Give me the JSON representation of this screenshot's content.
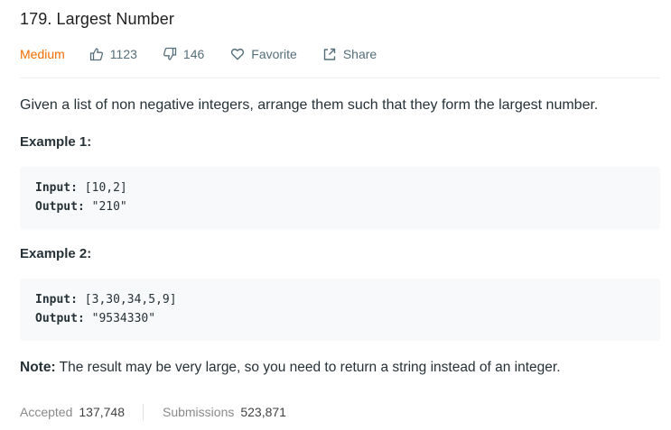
{
  "problem": {
    "title": "179. Largest Number",
    "difficulty": "Medium",
    "likes": "1123",
    "dislikes": "146",
    "favorite_label": "Favorite",
    "share_label": "Share"
  },
  "description": "Given a list of non negative integers, arrange them such that they form the largest number.",
  "examples": [
    {
      "title": "Example 1:",
      "input_label": "Input:",
      "input_value": "[10,2]",
      "output_label": "Output:",
      "output_value": "\"210\""
    },
    {
      "title": "Example 2:",
      "input_label": "Input:",
      "input_value": "[3,30,34,5,9]",
      "output_label": "Output:",
      "output_value": "\"9534330\""
    }
  ],
  "note": {
    "label": "Note:",
    "text": "The result may be very large, so you need to return a string instead of an integer."
  },
  "stats": {
    "accepted_label": "Accepted",
    "accepted_value": "137,748",
    "submissions_label": "Submissions",
    "submissions_value": "523,871"
  },
  "colors": {
    "difficulty_medium": "#ef6c00",
    "meta_text": "#546e7a",
    "code_bg": "#f7f9fa"
  },
  "icons": [
    "thumbs-up-icon",
    "thumbs-down-icon",
    "heart-icon",
    "share-icon"
  ]
}
